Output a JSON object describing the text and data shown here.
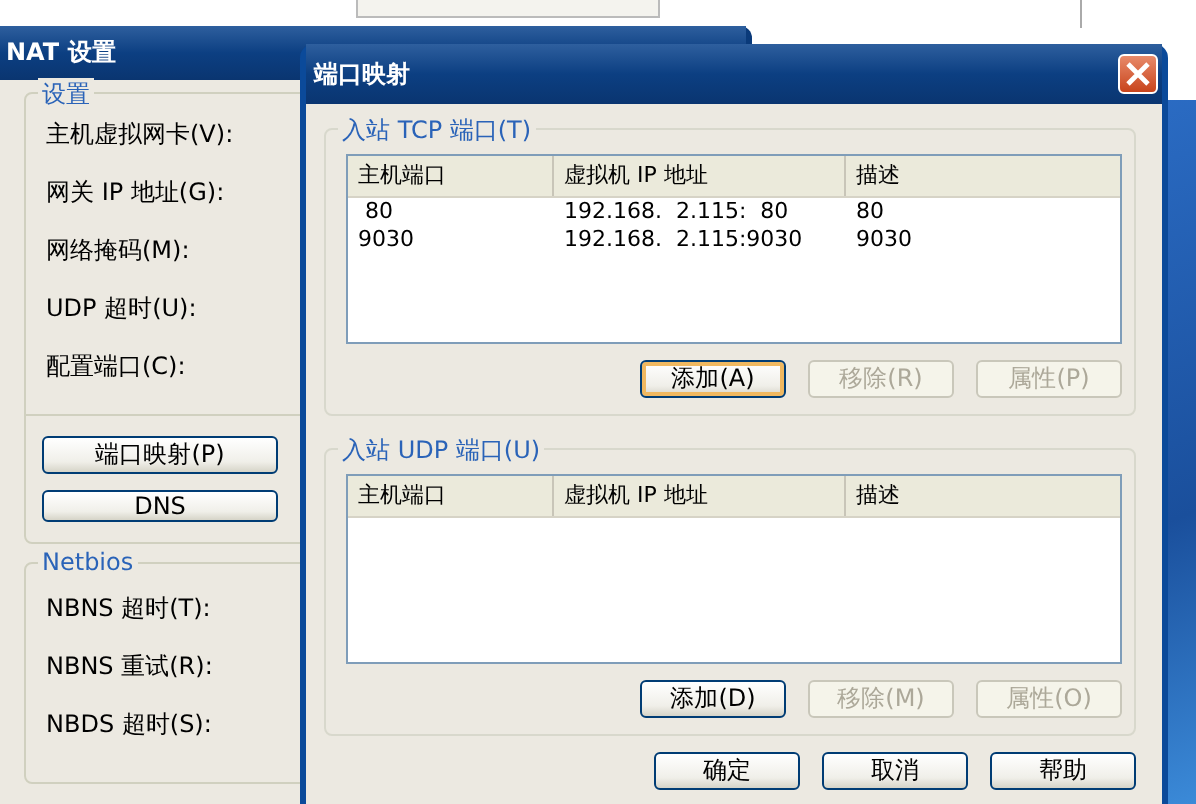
{
  "back_window": {
    "title": "NAT 设置",
    "settings_group": {
      "title": "设置",
      "labels": [
        "主机虚拟网卡(V):",
        "网关 IP 地址(G):",
        "网络掩码(M):",
        "UDP 超时(U):",
        "配置端口(C):"
      ],
      "buttons": [
        "端口映射(P)",
        "DNS"
      ]
    },
    "netbios_group": {
      "title": "Netbios",
      "labels": [
        "NBNS 超时(T):",
        "NBNS 重试(R):",
        "NBDS 超时(S):"
      ]
    }
  },
  "dialog": {
    "title": "端口映射",
    "groups": [
      {
        "title": "入站 TCP 端口(T)",
        "columns": [
          "主机端口",
          "虚拟机 IP 地址",
          "描述"
        ],
        "rows": [
          [
            " 80",
            "192.168.  2.115:  80",
            "80"
          ],
          [
            "9030",
            "192.168.  2.115:9030",
            "9030"
          ]
        ],
        "buttons": [
          {
            "label": "添加(A)",
            "disabled": false,
            "focused": true
          },
          {
            "label": "移除(R)",
            "disabled": true,
            "focused": false
          },
          {
            "label": "属性(P)",
            "disabled": true,
            "focused": false
          }
        ]
      },
      {
        "title": "入站 UDP 端口(U)",
        "columns": [
          "主机端口",
          "虚拟机 IP 地址",
          "描述"
        ],
        "buttons": [
          {
            "label": "添加(D)",
            "disabled": false,
            "focused": false
          },
          {
            "label": "移除(M)",
            "disabled": true,
            "focused": false
          },
          {
            "label": "属性(O)",
            "disabled": true,
            "focused": false
          }
        ]
      }
    ],
    "buttons": [
      "确定",
      "取消",
      "帮助"
    ]
  }
}
